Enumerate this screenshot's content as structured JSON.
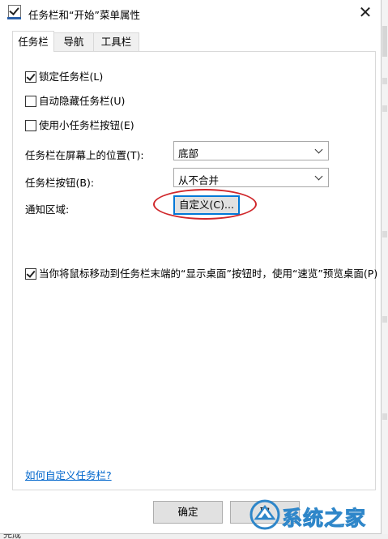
{
  "window": {
    "title": "任务栏和“开始”菜单属性",
    "close_glyph": "✕"
  },
  "tabs": [
    {
      "label": "任务栏",
      "active": true
    },
    {
      "label": "导航",
      "active": false
    },
    {
      "label": "工具栏",
      "active": false
    }
  ],
  "options": {
    "lock_taskbar": {
      "label": "锁定任务栏(L)",
      "checked": true
    },
    "auto_hide": {
      "label": "自动隐藏任务栏(U)",
      "checked": false
    },
    "small_buttons": {
      "label": "使用小任务栏按钮(E)",
      "checked": false
    },
    "peek": {
      "label": "当你将鼠标移动到任务栏末端的“显示桌面”按钮时，使用“速览”预览桌面(P)",
      "checked": true
    }
  },
  "location": {
    "label": "任务栏在屏幕上的位置(T):",
    "value": "底部"
  },
  "buttons_combine": {
    "label": "任务栏按钮(B):",
    "value": "从不合并"
  },
  "notification": {
    "label": "通知区域:",
    "customize_label": "自定义(C)...",
    "highlight_color": "#d0272b"
  },
  "help_link": "如何自定义任务栏?",
  "footer": {
    "ok_label": "确定",
    "cancel_label": "取",
    "status_text": "完成"
  },
  "watermark": {
    "text": "系统之家",
    "color": "#2e86c9"
  },
  "colors": {
    "focus_border": "#0078d7",
    "link": "#0066cc"
  }
}
